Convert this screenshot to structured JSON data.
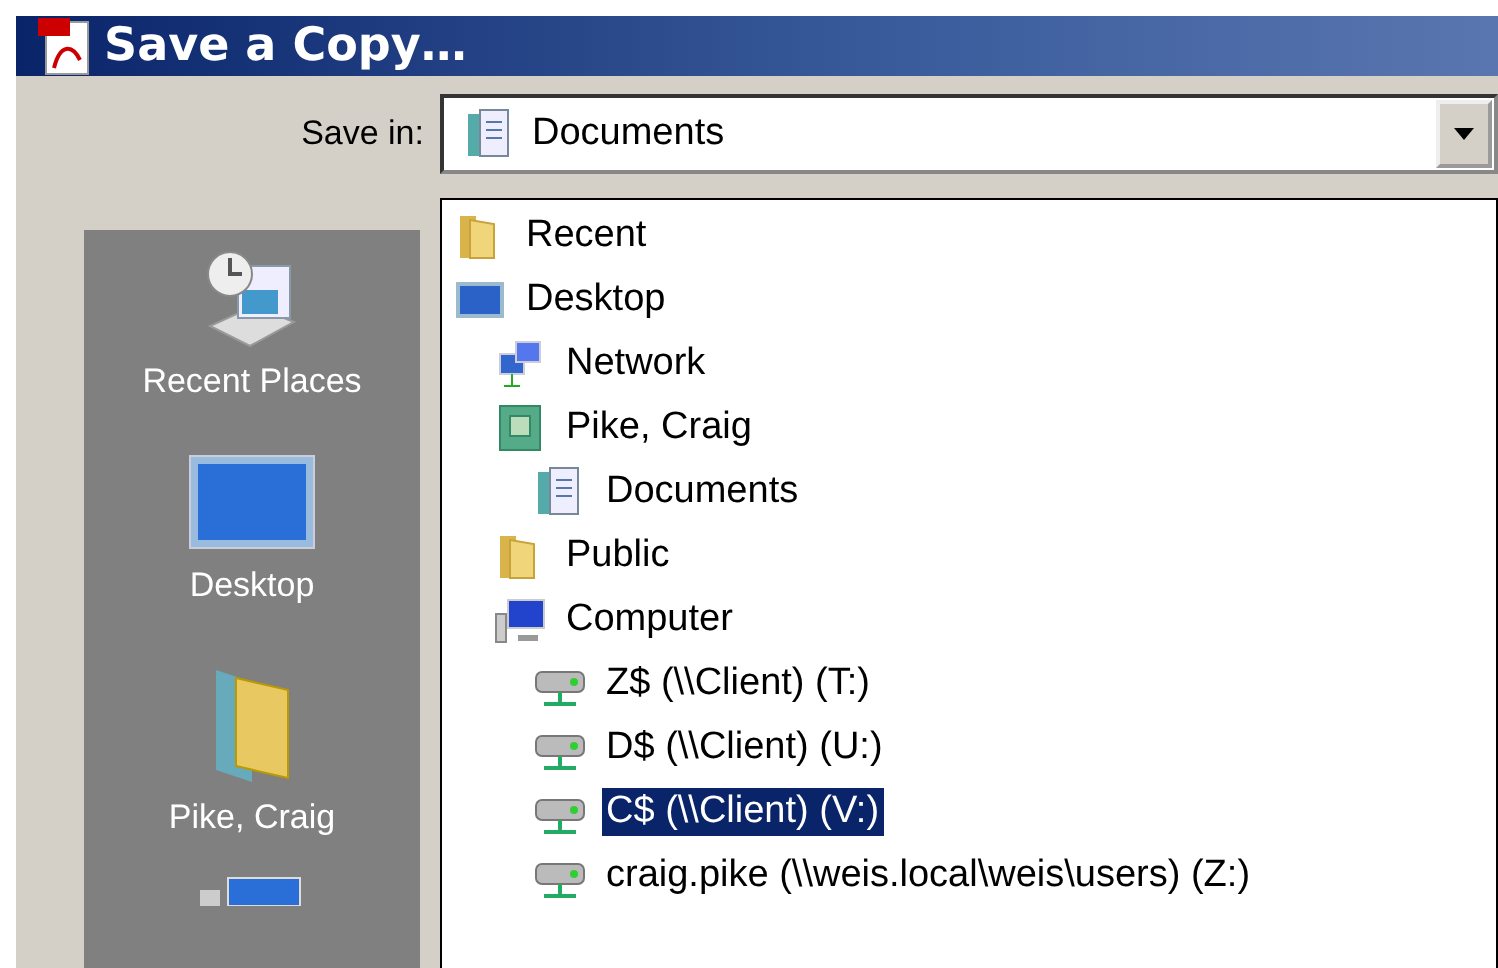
{
  "window": {
    "title": "Save a Copy…"
  },
  "save_in": {
    "label": "Save in:",
    "value": "Documents",
    "kind": "documents"
  },
  "places": [
    {
      "label": "Recent Places",
      "kind": "recent"
    },
    {
      "label": "Desktop",
      "kind": "desktop"
    },
    {
      "label": "Pike, Craig",
      "kind": "userfolder"
    },
    {
      "kind": "computer"
    }
  ],
  "dropdown_list": [
    {
      "label": "Recent",
      "kind": "folder",
      "selected": false
    },
    {
      "label": "Desktop",
      "kind": "desktop",
      "selected": false,
      "children": [
        {
          "label": "Network",
          "kind": "network",
          "selected": false
        },
        {
          "label": "Pike, Craig",
          "kind": "user",
          "selected": false,
          "children": [
            {
              "label": "Documents",
              "kind": "documents",
              "selected": false
            }
          ]
        },
        {
          "label": "Public",
          "kind": "folder",
          "selected": false
        },
        {
          "label": "Computer",
          "kind": "computer",
          "selected": false,
          "children": [
            {
              "label": "Z$ (\\\\Client) (T:)",
              "kind": "drive",
              "selected": false
            },
            {
              "label": "D$ (\\\\Client) (U:)",
              "kind": "drive",
              "selected": false
            },
            {
              "label": "C$ (\\\\Client) (V:)",
              "kind": "drive",
              "selected": true
            },
            {
              "label": "craig.pike (\\\\weis.local\\weis\\users) (Z:)",
              "kind": "drive",
              "selected": false
            }
          ]
        }
      ]
    }
  ]
}
